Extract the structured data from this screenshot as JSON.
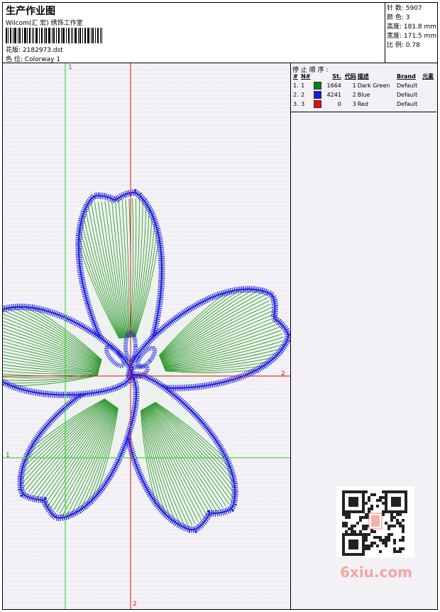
{
  "header": {
    "title": "生产作业图",
    "company": "Wilcom(汇 宏) 绣饰工作室",
    "design_label": "花版:",
    "design_value": "2182973.dst",
    "colorway_label": "色 位:",
    "colorway_value": "Colorway 1"
  },
  "stats": {
    "stitches": "针 数: 5907",
    "colors": "颜 色: 3",
    "height": "高度: 181.8 mm",
    "width": "宽度: 171.5 mm",
    "scale": "比 例: 0.78"
  },
  "guides": {
    "v1": "1",
    "h1": "1",
    "h2": "2",
    "v2": "2"
  },
  "sequence": {
    "title": "停 止 顺 序 :",
    "headers": [
      "#",
      "N#",
      "St.",
      "代码",
      "描述",
      "Brand",
      "元素"
    ],
    "rows": [
      {
        "idx": "1.",
        "n": "1",
        "color": "#0d7d1b",
        "st": "1664",
        "code": "1",
        "desc": "Dark Green",
        "brand": "Default"
      },
      {
        "idx": "2.",
        "n": "2",
        "color": "#1a1adb",
        "st": "4241",
        "code": "2",
        "desc": "Blue",
        "brand": "Default"
      },
      {
        "idx": "3.",
        "n": "3",
        "color": "#e01010",
        "st": "0",
        "code": "3",
        "desc": "Red",
        "brand": "Default"
      }
    ]
  },
  "colors": {
    "fill_green": "#1e8f1e",
    "outline_blue": "#1f1fe0",
    "guide_green": "#22cc22",
    "guide_red": "#dd1111"
  },
  "watermark": "6xiu.com"
}
